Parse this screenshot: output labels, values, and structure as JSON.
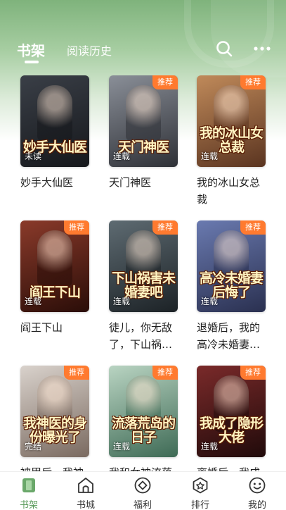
{
  "header": {
    "tabs": [
      {
        "label": "书架",
        "active": true
      },
      {
        "label": "阅读历史",
        "active": false
      }
    ],
    "icons": [
      "search-icon",
      "more-icon"
    ]
  },
  "colors": {
    "header_green": "#7fb37c",
    "accent_green": "#5a9b5b",
    "badge_orange": "#ff7a2f"
  },
  "books": [
    {
      "title": "妙手大仙医",
      "cover_text": "妙手大仙医",
      "status": "未读",
      "recommended": false,
      "palette": [
        "#3a3f47",
        "#15171b"
      ]
    },
    {
      "title": "天门神医",
      "cover_text": "天门神医",
      "status": "连载",
      "recommended": true,
      "palette": [
        "#8a8f98",
        "#2e3036"
      ]
    },
    {
      "title": "我的冰山女总裁",
      "cover_text": "我的冰山女总裁",
      "status": "连载",
      "recommended": true,
      "palette": [
        "#c08a5a",
        "#5a3420"
      ]
    },
    {
      "title": "阎王下山",
      "cover_text": "阎王下山",
      "status": "连载",
      "recommended": true,
      "palette": [
        "#8a3a2a",
        "#2a0d08"
      ]
    },
    {
      "title": "徒儿，你无敌了，下山祸害未婚妻吧",
      "cover_text": "下山祸害未婚妻吧",
      "status": "连载",
      "recommended": true,
      "palette": [
        "#5e6b72",
        "#1c2226"
      ]
    },
    {
      "title": "退婚后，我的高冷未婚妻后悔了",
      "cover_text": "高冷未婚妻后悔了",
      "status": "连载",
      "recommended": true,
      "palette": [
        "#6a7ab0",
        "#2a3050"
      ]
    },
    {
      "title": "被甩后，我神医的身份曝光了",
      "cover_text": "我神医的身份曝光了",
      "status": "完结",
      "recommended": true,
      "palette": [
        "#d9d2cc",
        "#7a6a60"
      ]
    },
    {
      "title": "我和女神流落荒岛的日子",
      "cover_text": "流落荒岛的日子",
      "status": "连载",
      "recommended": true,
      "palette": [
        "#b9d4c2",
        "#3e6a55"
      ]
    },
    {
      "title": "离婚后，我成了隐形大佬",
      "cover_text": "我成了隐形大佬",
      "status": "连载",
      "recommended": true,
      "palette": [
        "#7a2a2a",
        "#200a0a"
      ]
    }
  ],
  "badge_label": "推荐",
  "bottom_nav": [
    {
      "label": "书架",
      "icon": "bookshelf-icon",
      "active": true
    },
    {
      "label": "书城",
      "icon": "bookstore-icon",
      "active": false
    },
    {
      "label": "福利",
      "icon": "welfare-icon",
      "active": false
    },
    {
      "label": "排行",
      "icon": "ranking-icon",
      "active": false
    },
    {
      "label": "我的",
      "icon": "profile-icon",
      "active": false
    }
  ]
}
